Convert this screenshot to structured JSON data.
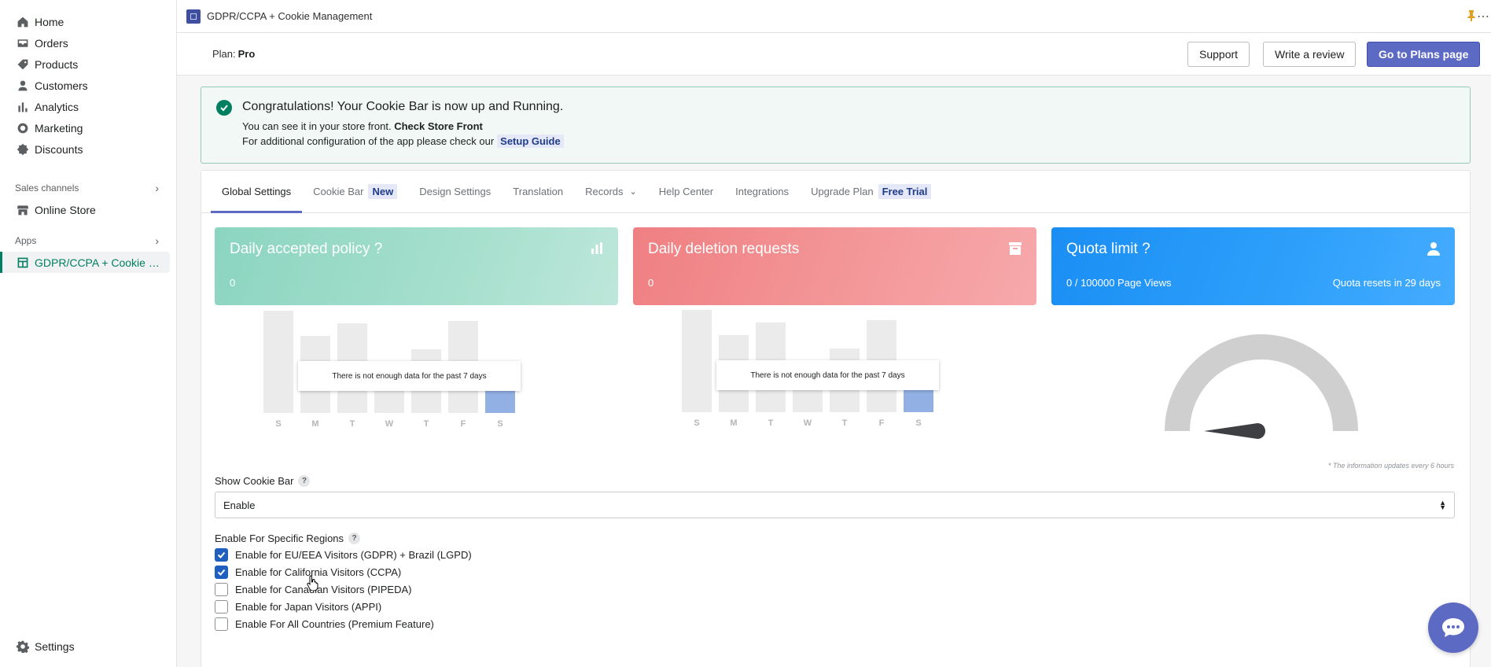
{
  "sidebar": {
    "items": [
      {
        "label": "Home",
        "icon": "home-icon"
      },
      {
        "label": "Orders",
        "icon": "orders-icon"
      },
      {
        "label": "Products",
        "icon": "tag-icon"
      },
      {
        "label": "Customers",
        "icon": "person-icon"
      },
      {
        "label": "Analytics",
        "icon": "bar-chart-icon"
      },
      {
        "label": "Marketing",
        "icon": "target-icon"
      },
      {
        "label": "Discounts",
        "icon": "discount-icon"
      }
    ],
    "sales_channels_label": "Sales channels",
    "online_store_label": "Online Store",
    "apps_label": "Apps",
    "app_item_label": "GDPR/CCPA + Cookie Ma...",
    "settings_label": "Settings"
  },
  "appbar": {
    "title": "GDPR/CCPA + Cookie Management"
  },
  "planbar": {
    "plan_label": "Plan:",
    "plan_value": "Pro",
    "support_button": "Support",
    "review_button": "Write a review",
    "plans_button": "Go to Plans page"
  },
  "banner": {
    "heading": "Congratulations! Your Cookie Bar is now up and Running.",
    "line1_text": "You can see it in your store front.",
    "line1_link": "Check Store Front",
    "line2_text": "For additional configuration of the app please check our",
    "line2_link": "Setup Guide"
  },
  "tabs": [
    {
      "label": "Global Settings",
      "active": true
    },
    {
      "label": "Cookie Bar",
      "badge": "New"
    },
    {
      "label": "Design Settings"
    },
    {
      "label": "Translation"
    },
    {
      "label": "Records"
    },
    {
      "label": "Help Center"
    },
    {
      "label": "Integrations"
    },
    {
      "label": "Upgrade Plan",
      "badge": "Free Trial"
    }
  ],
  "stats": {
    "accepted": {
      "title": "Daily accepted policy ?",
      "value": "0",
      "color": "#8bd5c0"
    },
    "deletion": {
      "title": "Daily deletion requests",
      "value": "0",
      "color": "#ef7f82"
    },
    "quota": {
      "title": "Quota limit ?",
      "value": "0 / 100000 Page Views",
      "reset": "Quota resets in 29 days",
      "color": "#1a8ef4"
    }
  },
  "charts": {
    "days": [
      "S",
      "M",
      "T",
      "W",
      "T",
      "F",
      "S"
    ],
    "no_data_text": "There is not enough data for the past 7 days",
    "placeholder_levels": [
      1.0,
      0.75,
      0.88,
      0.32,
      0.62,
      0.9,
      0.3
    ],
    "highlight_color": "#92b0e3"
  },
  "gauge": {
    "level": 0,
    "note": "* The information updates every 6 hours"
  },
  "show_cookie_bar": {
    "label": "Show Cookie Bar",
    "value": "Enable"
  },
  "regions": {
    "label": "Enable For Specific Regions",
    "options": [
      {
        "label": "Enable for EU/EEA Visitors (GDPR) + Brazil (LGPD)",
        "checked": true
      },
      {
        "label": "Enable for California Visitors (CCPA)",
        "checked": true
      },
      {
        "label": "Enable for Canadian Visitors (PIPEDA)",
        "checked": false
      },
      {
        "label": "Enable for Japan Visitors (APPI)",
        "checked": false
      },
      {
        "label": "Enable For All Countries (Premium Feature)",
        "checked": false
      }
    ]
  },
  "accent_color": "#5c6ac4"
}
